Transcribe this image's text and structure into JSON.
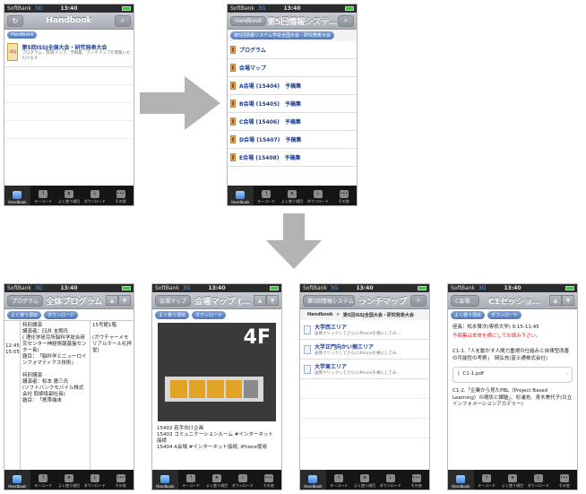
{
  "status": {
    "carrier": "SoftBank",
    "network": "3G",
    "time": "13:40"
  },
  "tabs": [
    "Handbook",
    "キーコード",
    "よく使う項目",
    "ダウンロード",
    "その他"
  ],
  "screen1": {
    "title": "Handbook",
    "chip": "Handbook",
    "item_title": "第5回ISSJ全国大会・研究発表大会",
    "item_sub": "プログラム、会場マップ、予稿集、ランチマップを閲覧いただけます"
  },
  "screen2": {
    "back": "Handbook",
    "title": "第5回情報システ…",
    "crumb": "第5回情報システム学会全国大会・研究発表大会",
    "items": [
      "プログラム",
      "会場マップ",
      "A会場 (15404)　予稿集",
      "B会場 (15405)　予稿集",
      "C会場 (15406)　予稿集",
      "D会場 (15407)　予稿集",
      "E会場 (15408)　予稿集"
    ]
  },
  "screen3": {
    "back": "プログラム",
    "title": "全体プログラム",
    "chips": [
      "よく使う項目",
      "ダウンロード"
    ],
    "time": "12:45 15:05",
    "left_text": "特別講演\n講演者：臼井 支朗氏\n( 理化学研究所脳科学総合研究センター神経情報基盤センター長)\n題目：　「脳科学とニューロインフォマティクス技術」\n\n特別講演\n講演者：松本 徹三氏\n(ソフトバンクモバイル株式会社 取締役副社長)\n題目：　「携帯端末",
    "right_text": "15号館1階\n\n(ガウチャーメモリアルホール礼拝堂)"
  },
  "screen4": {
    "back": "会場マップ",
    "title": "会場マップ (…",
    "chips": [
      "よく使う項目",
      "ダウンロード"
    ],
    "floor": "4F",
    "text": "15402 若手向け企画\n15403 コミュニケーションルーム #インターネット接続\n15404 A会場 #インターネット接続, iPhone使用"
  },
  "screen5": {
    "back": "第5回情報システム…",
    "title": "ランチマップ",
    "crumb_a": "Handbook",
    "crumb_b": "第5回ISSJ全国大会・研究発表大会",
    "items": [
      {
        "t": "大学西エリア",
        "s": "画像クリックしてさらにiPhoneを横にしてみ…"
      },
      {
        "t": "大学正門向かい側エリア",
        "s": "画像クリックしてさらにiPhoneを横にしてみ…"
      },
      {
        "t": "大学東エリア",
        "s": "画像クリックしてさらにiPhoneを横にしてみ…"
      }
    ]
  },
  "screen6": {
    "back": "C会場…",
    "title": "C1セッショ…",
    "chips": [
      "よく使う項目",
      "ダウンロード"
    ],
    "chair": "座長：松永賢次(専修大学) 9:15-11:45",
    "note": "予稿集は本体を横にしてお読み下さい。",
    "p1": "C1-1.「人を動かす人間力重視の仕組みと自律型改善の可能性の考察」　岡弘充(富士通株式会社)",
    "file": "C1-1.pdf",
    "p2": "C1-2.「企業から見たPBL（Project Based Learning）の現状と課題」、杉浦充、青木美代子(日立インフォメーションアカデミー)"
  }
}
